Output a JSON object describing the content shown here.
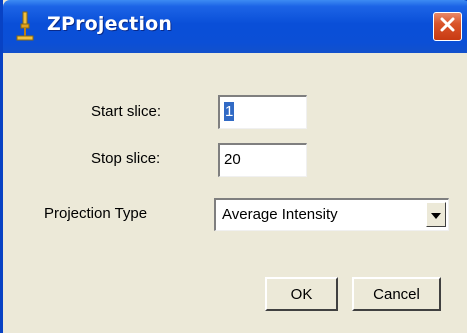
{
  "window": {
    "title": "ZProjection",
    "icon": "microscope-icon",
    "close_icon": "close-icon"
  },
  "form": {
    "start_slice": {
      "label": "Start slice:",
      "value": "1"
    },
    "stop_slice": {
      "label": "Stop slice:",
      "value": "20"
    },
    "projection_type": {
      "label": "Projection Type",
      "value": "Average Intensity"
    }
  },
  "buttons": {
    "ok": "OK",
    "cancel": "Cancel"
  },
  "colors": {
    "titlebar": "#0a4fd8",
    "dialog_bg": "#ece9d8",
    "selection": "#316ac5",
    "close_button": "#d9542a"
  }
}
